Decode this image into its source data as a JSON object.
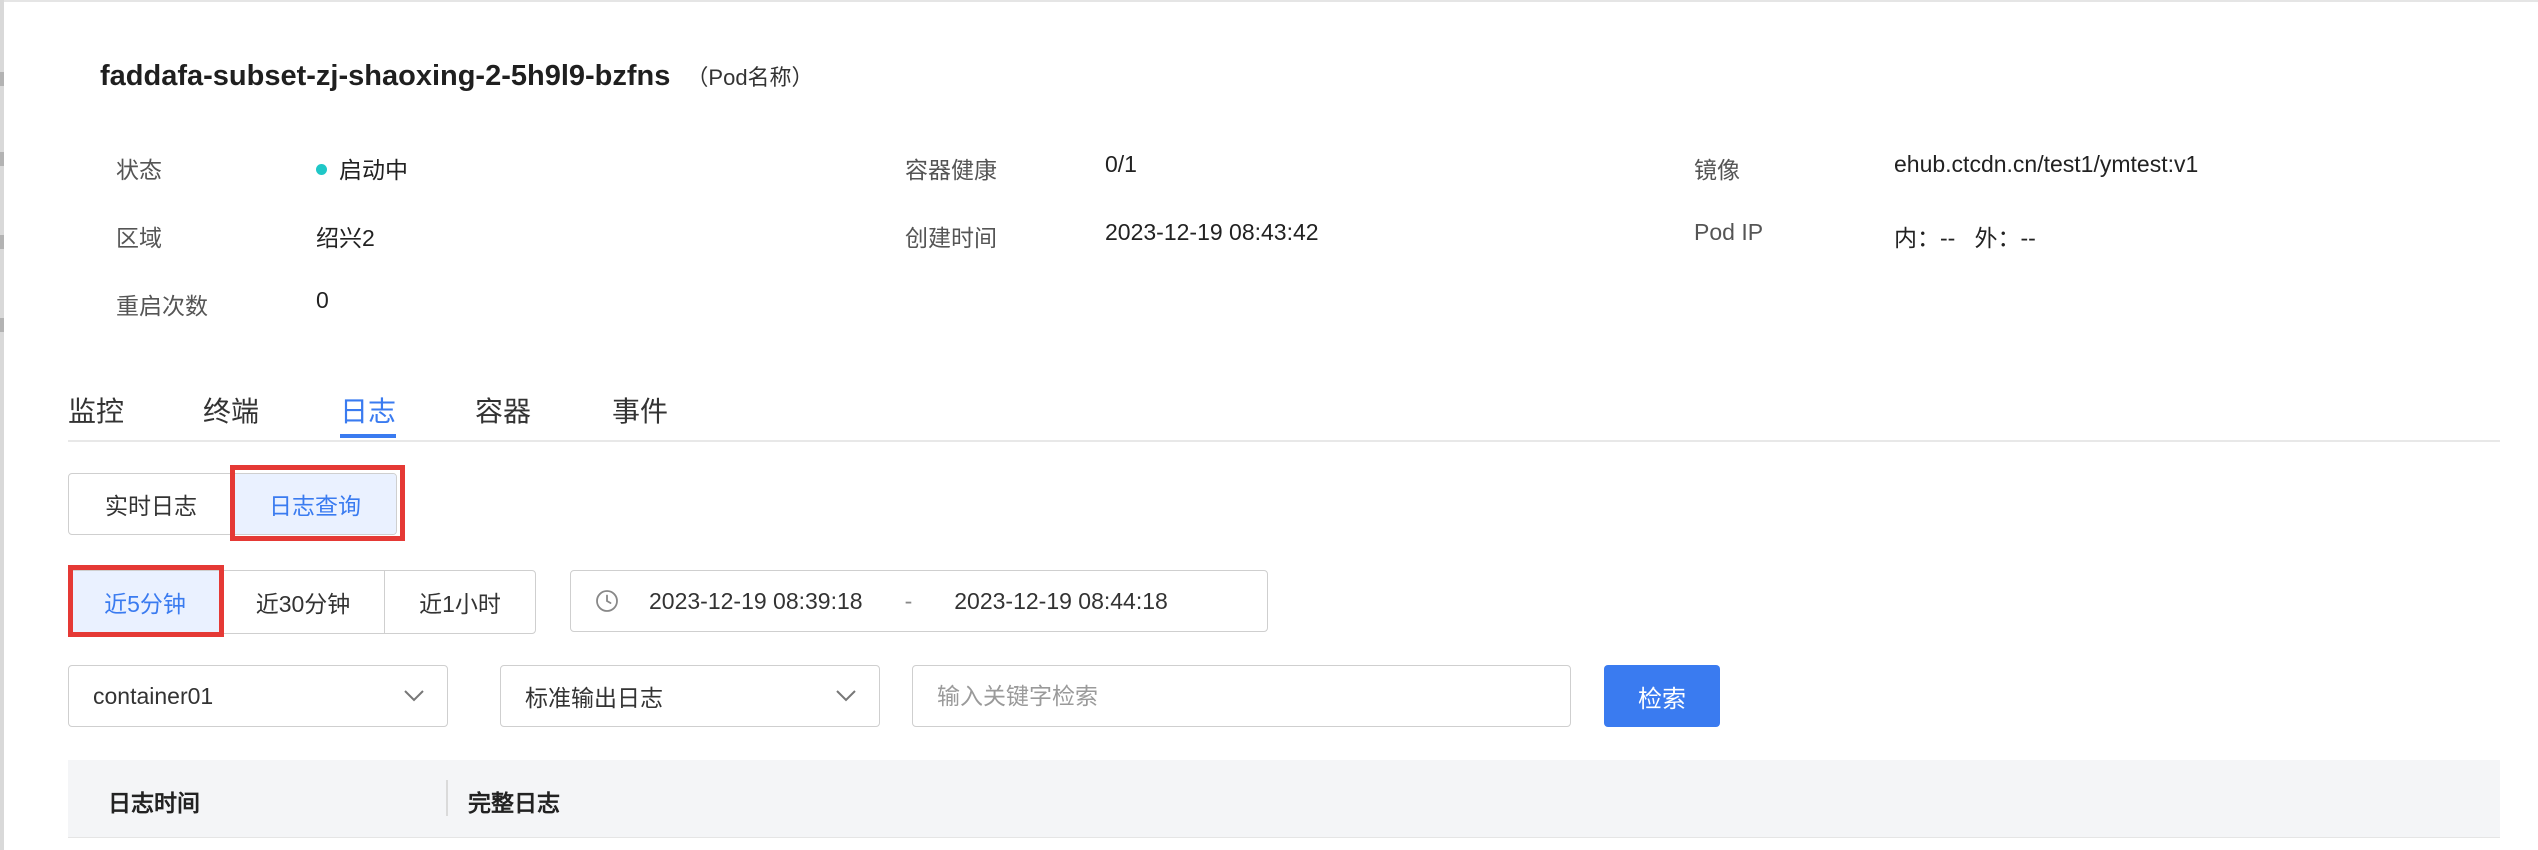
{
  "pod": {
    "name": "faddafa-subset-zj-shaoxing-2-5h9l9-bzfns",
    "name_suffix": "（Pod名称）"
  },
  "info": {
    "status_label": "状态",
    "status_value": "启动中",
    "status_color": "#1fc7c7",
    "health_label": "容器健康",
    "health_value": "0/1",
    "image_label": "镜像",
    "image_value": "ehub.ctcdn.cn/test1/ymtest:v1",
    "region_label": "区域",
    "region_value": "绍兴2",
    "created_label": "创建时间",
    "created_value": "2023-12-19 08:43:42",
    "ip_label": "Pod IP",
    "ip_value": "内：--   外：--",
    "restart_label": "重启次数",
    "restart_value": "0"
  },
  "tabs": [
    {
      "label": "监控"
    },
    {
      "label": "终端"
    },
    {
      "label": "日志",
      "active": true
    },
    {
      "label": "容器"
    },
    {
      "label": "事件"
    }
  ],
  "log_mode": {
    "realtime_label": "实时日志",
    "query_label": "日志查询",
    "active": "query"
  },
  "time_quick": {
    "options": [
      "近5分钟",
      "近30分钟",
      "近1小时"
    ],
    "selected": "近5分钟"
  },
  "time_range": {
    "start": "2023-12-19 08:39:18",
    "separator": "-",
    "end": "2023-12-19 08:44:18"
  },
  "filters": {
    "container": "container01",
    "log_type": "标准输出日志",
    "keyword_placeholder": "输入关键字检索",
    "keyword_value": ""
  },
  "search_button": "检索",
  "table": {
    "columns": [
      "日志时间",
      "完整日志"
    ]
  },
  "colors": {
    "accent": "#3a7bf0",
    "highlight": "#e53935"
  }
}
